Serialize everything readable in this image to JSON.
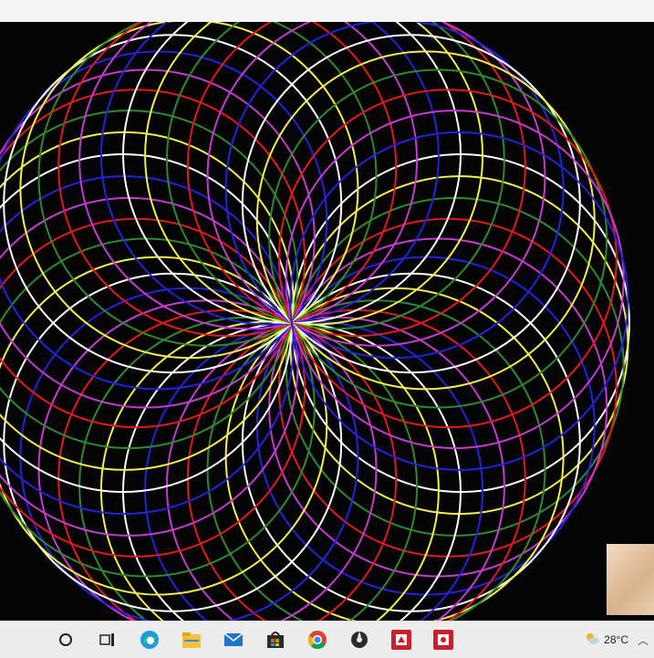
{
  "spirograph": {
    "ring_colors": [
      "#ffffff",
      "#f3f04a",
      "#2e8a2e",
      "#e01b1b",
      "#c43bd0",
      "#2323d8"
    ],
    "background": "#050404"
  },
  "taskbar": {
    "icons": [
      {
        "name": "search-circle-icon"
      },
      {
        "name": "task-view-icon"
      },
      {
        "name": "edge-browser-icon"
      },
      {
        "name": "file-explorer-icon"
      },
      {
        "name": "mail-icon"
      },
      {
        "name": "store-icon"
      },
      {
        "name": "chrome-icon"
      },
      {
        "name": "media-app-icon"
      },
      {
        "name": "red-app-icon-1"
      },
      {
        "name": "red-app-icon-2"
      }
    ],
    "weather_temp": "28°C"
  }
}
